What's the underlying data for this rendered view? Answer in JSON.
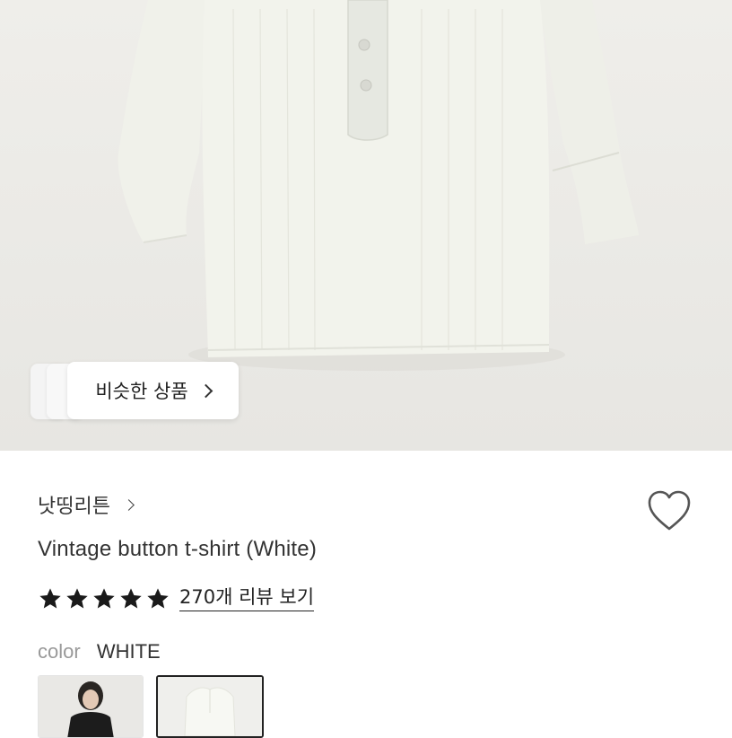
{
  "similar_products": {
    "label": "비슷한 상품"
  },
  "product": {
    "brand": "낫띵리튼",
    "title": "Vintage button t-shirt (White)",
    "rating_stars": 5,
    "reviews_link": "270개 리뷰 보기",
    "color_label": "color",
    "color_value": "WHITE"
  },
  "colors": {
    "accent": "#222222",
    "background": "#ecebe7",
    "shirt": "#f1f2ec"
  },
  "icons": [
    "chevron-right-icon",
    "heart-icon",
    "star-icon"
  ]
}
